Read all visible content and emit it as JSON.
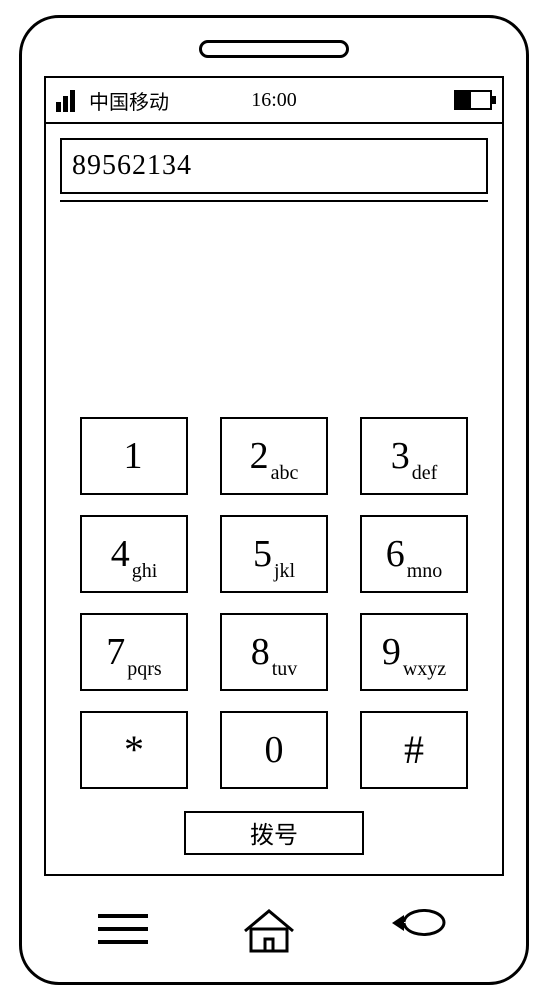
{
  "status": {
    "carrier": "中国移动",
    "time": "16:00",
    "battery_pct": 45
  },
  "dialer": {
    "entered_number": "89562134",
    "dial_label": "拨号",
    "keys": [
      {
        "digit": "1",
        "letters": ""
      },
      {
        "digit": "2",
        "letters": "abc"
      },
      {
        "digit": "3",
        "letters": "def"
      },
      {
        "digit": "4",
        "letters": "ghi"
      },
      {
        "digit": "5",
        "letters": "jkl"
      },
      {
        "digit": "6",
        "letters": "mno"
      },
      {
        "digit": "7",
        "letters": "pqrs"
      },
      {
        "digit": "8",
        "letters": "tuv"
      },
      {
        "digit": "9",
        "letters": "wxyz"
      },
      {
        "digit": "*",
        "letters": ""
      },
      {
        "digit": "0",
        "letters": ""
      },
      {
        "digit": "#",
        "letters": ""
      }
    ]
  }
}
